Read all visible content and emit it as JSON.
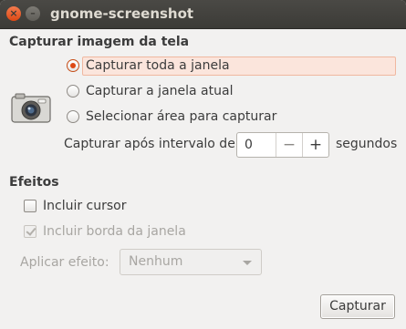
{
  "window": {
    "title": "gnome-screenshot",
    "close_icon": "close-icon",
    "minimize_icon": "minimize-icon"
  },
  "capture": {
    "section_title": "Capturar imagem da tela",
    "camera_icon": "camera-icon",
    "options": [
      {
        "label": "Capturar toda a janela",
        "checked": true
      },
      {
        "label": "Capturar a janela atual",
        "checked": false
      },
      {
        "label": "Selecionar área para capturar",
        "checked": false
      }
    ],
    "delay_label": "Capturar após intervalo de",
    "delay_value": "0",
    "minus": "−",
    "plus": "+",
    "delay_units": "segundos"
  },
  "effects": {
    "section_title": "Efeitos",
    "include_cursor": {
      "label": "Incluir cursor",
      "checked": false
    },
    "include_border": {
      "label": "Incluir borda da janela",
      "checked": true,
      "disabled": true
    },
    "apply_effect_label": "Aplicar efeito:",
    "apply_effect_value": "Nenhum"
  },
  "actions": {
    "capture_label": "Capturar"
  },
  "colors": {
    "accent": "#dd4814",
    "titlebar": "#3c3b37",
    "background": "#f2f1f0"
  }
}
